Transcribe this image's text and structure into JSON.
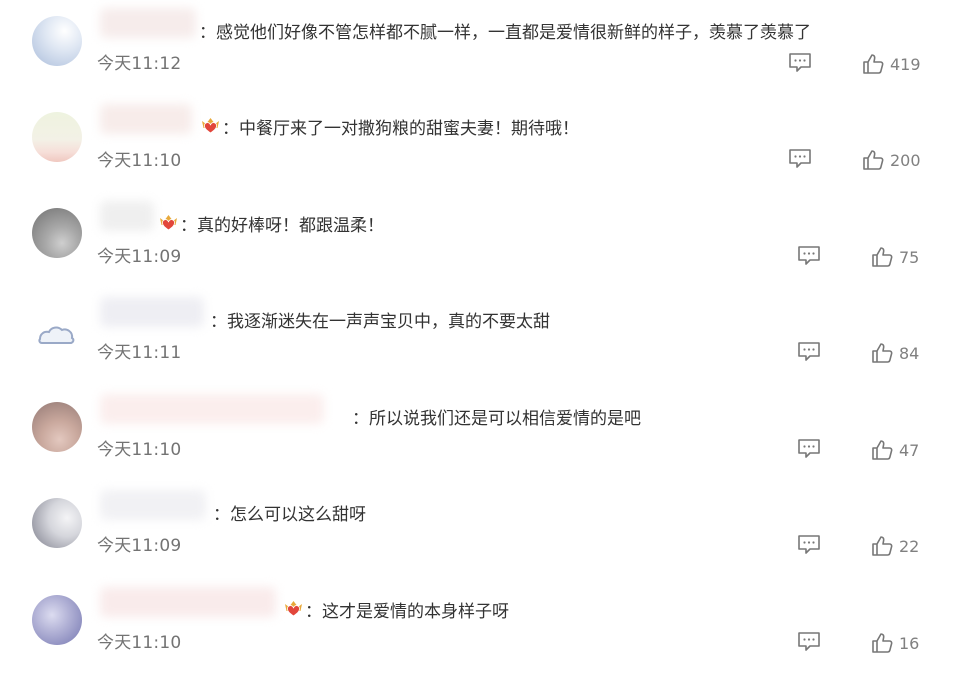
{
  "comments": [
    {
      "text": "：感觉他们好像不管怎样都不腻一样，一直都是爱情很新鲜的样子，羡慕了羡慕了",
      "time": "今天11:12",
      "likes": "419",
      "has_badge": false
    },
    {
      "text": "：中餐厅来了一对撒狗粮的甜蜜夫妻！期待哦！",
      "time": "今天11:10",
      "likes": "200",
      "has_badge": true
    },
    {
      "text": "：真的好棒呀！都跟温柔！",
      "time": "今天11:09",
      "likes": "75",
      "has_badge": true
    },
    {
      "text": "：我逐渐迷失在一声声宝贝中，真的不要太甜",
      "time": "今天11:11",
      "likes": "84",
      "has_badge": false
    },
    {
      "text": "：所以说我们还是可以相信爱情的是吧",
      "time": "今天11:10",
      "likes": "47",
      "has_badge": false
    },
    {
      "text": "：怎么可以这么甜呀",
      "time": "今天11:09",
      "likes": "22",
      "has_badge": false
    },
    {
      "text": "：这才是爱情的本身样子呀",
      "time": "今天11:10",
      "likes": "16",
      "has_badge": true
    }
  ],
  "icons": {
    "reply": "comment-bubble-icon",
    "like": "thumbs-up-icon",
    "badge": "crown-heart-badge-icon"
  },
  "colors": {
    "text": "#333333",
    "time": "#737373",
    "icon": "#777777",
    "badge_gold": "#e8a93a",
    "badge_red": "#e2463b"
  }
}
